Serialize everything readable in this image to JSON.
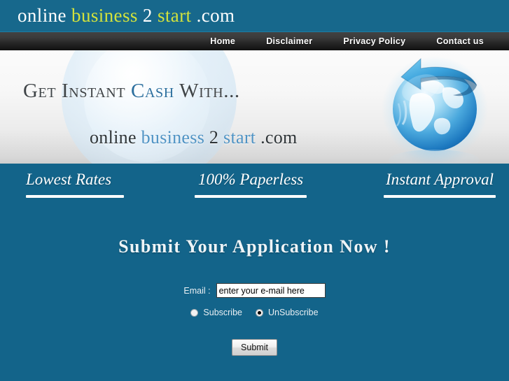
{
  "header": {
    "logo": {
      "part1": "online ",
      "part2": "business",
      "part3": " 2 ",
      "part4": "start",
      "part5": " .com"
    },
    "accent_color": "#d2e23c",
    "bar_color": "#17688c"
  },
  "nav": {
    "items": [
      {
        "label": "Home"
      },
      {
        "label": "Disclaimer"
      },
      {
        "label": "Privacy Policy"
      },
      {
        "label": "Contact us"
      }
    ]
  },
  "banner": {
    "headline": {
      "before": "Get Instant ",
      "accent": "Cash",
      "after": " With..."
    },
    "wordmark": {
      "part1": "online ",
      "part2": "business",
      "part3": " 2 ",
      "part4": "start",
      "part5": " .com"
    },
    "accent_color": "#2c6f9e",
    "graphic": "globe-with-arrow-image"
  },
  "features": [
    {
      "label": "Lowest Rates"
    },
    {
      "label": "100% Paperless"
    },
    {
      "label": "Instant Approval"
    }
  ],
  "form": {
    "title": "Submit Your Application Now !",
    "email_label": "Email :",
    "email_value": "enter your e-mail here",
    "email_placeholder": "enter your e-mail here",
    "options": [
      {
        "label": "Subscribe",
        "selected": false
      },
      {
        "label": "UnSubscribe",
        "selected": true
      }
    ],
    "submit_label": "Submit",
    "background_color": "#13648a"
  }
}
